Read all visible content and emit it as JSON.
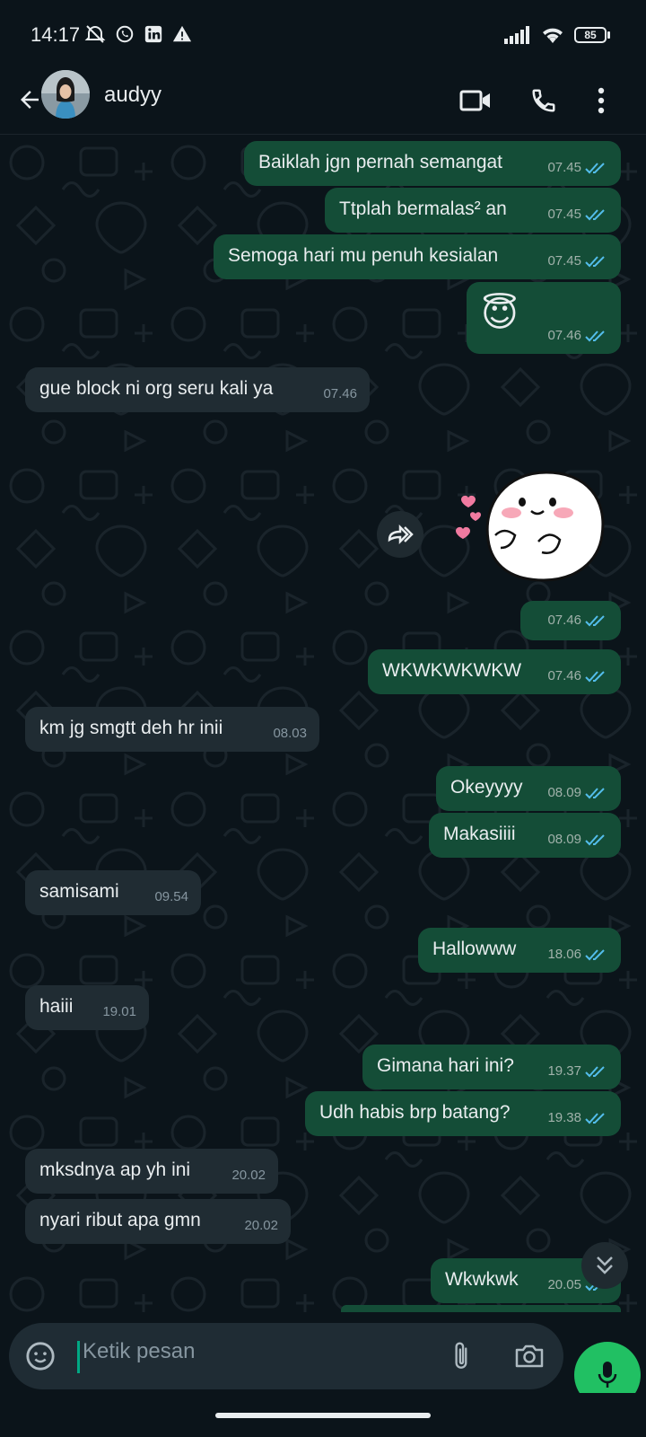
{
  "status_bar": {
    "time": "14:17",
    "battery": "85",
    "icons": [
      "alarm-off-icon",
      "whatsapp-icon",
      "linkedin-icon",
      "warning-icon",
      "signal-icon",
      "wifi-icon",
      "battery-icon"
    ]
  },
  "header": {
    "contact_name": "audyy",
    "actions": [
      "video-call-icon",
      "phone-icon",
      "more-vert-icon"
    ]
  },
  "colors": {
    "background": "#0b141a",
    "outgoing_bubble": "#144d37",
    "incoming_bubble": "#202c33",
    "read_tick": "#53bdeb",
    "accent": "#21c063"
  },
  "messages": [
    {
      "dir": "out",
      "text": "Baiklah jgn pernah semangat",
      "time": "07.45"
    },
    {
      "dir": "out",
      "text": "Ttplah bermalas² an",
      "time": "07.45"
    },
    {
      "dir": "out",
      "text": "Semoga hari mu penuh kesialan",
      "time": "07.45"
    },
    {
      "dir": "out",
      "text": "😇",
      "time": "07.46"
    },
    {
      "dir": "in",
      "text": "gue block ni org seru kali ya",
      "time": "07.46"
    },
    {
      "dir": "out",
      "text": "",
      "time": "07.46",
      "sticker": "blushing-mochi-sticker"
    },
    {
      "dir": "out",
      "text": "WKWKWKWKW",
      "time": "07.46"
    },
    {
      "dir": "in",
      "text": "km jg smgtt deh hr inii",
      "time": "08.03"
    },
    {
      "dir": "out",
      "text": "Okeyyyy",
      "time": "08.09"
    },
    {
      "dir": "out",
      "text": "Makasiiii",
      "time": "08.09"
    },
    {
      "dir": "in",
      "text": "samisami",
      "time": "09.54"
    },
    {
      "dir": "out",
      "text": "Hallowww",
      "time": "18.06"
    },
    {
      "dir": "in",
      "text": "haiii",
      "time": "19.01"
    },
    {
      "dir": "out",
      "text": "Gimana hari ini?",
      "time": "19.37"
    },
    {
      "dir": "out",
      "text": "Udh habis brp batang?",
      "time": "19.38"
    },
    {
      "dir": "in",
      "text": "mksdnya ap yh ini",
      "time": "20.02"
    },
    {
      "dir": "in",
      "text": "nyari ribut apa gmn",
      "time": "20.02"
    },
    {
      "dir": "out",
      "text": "Wkwkwk",
      "time": "20.05"
    }
  ],
  "composer": {
    "placeholder": "Ketik pesan"
  }
}
